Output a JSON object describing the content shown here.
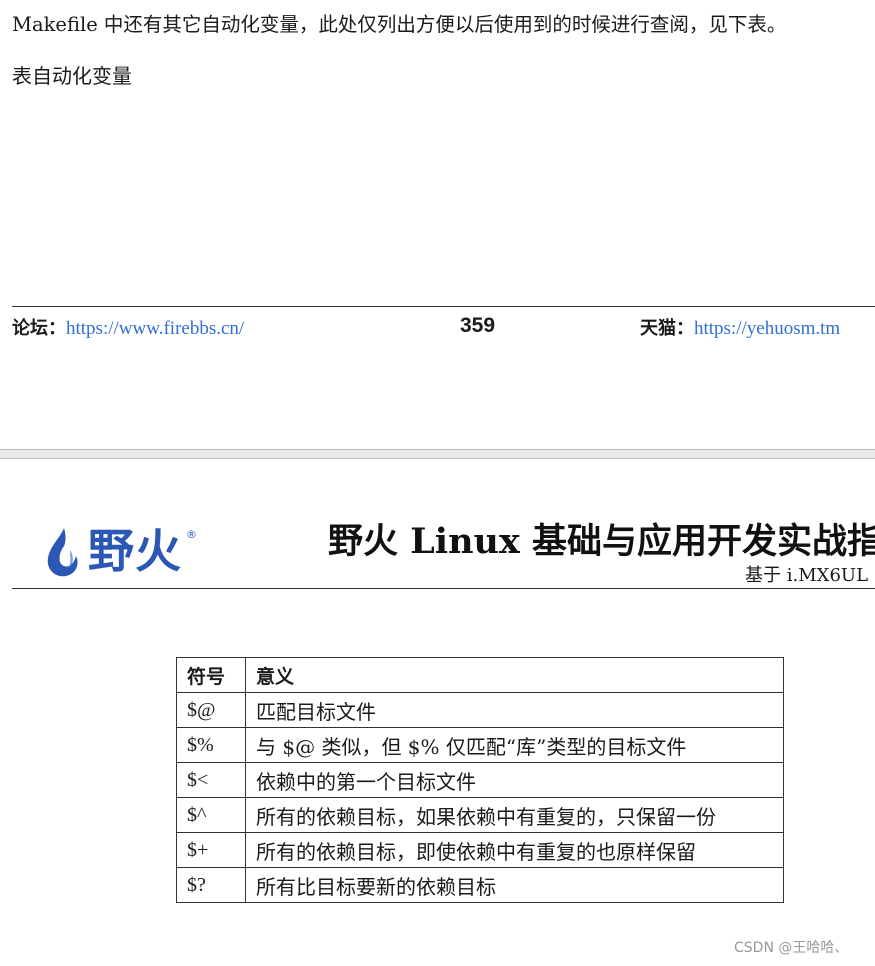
{
  "page_top": {
    "paragraph": "Makefile 中还有其它自动化变量，此处仅列出方便以后使用到的时候进行查阅，见下表。",
    "table_caption": "表自动化变量",
    "footer": {
      "forum_label": "论坛：",
      "forum_url": "https://www.firebbs.cn/",
      "page_number": "359",
      "tmall_label": "天猫：",
      "tmall_url": "https://yehuosm.tm"
    }
  },
  "page_bottom": {
    "logo_text": "野火",
    "logo_reg": "®",
    "book_title": "野火 Linux 基础与应用开发实战指",
    "book_subtitle": "基于 i.MX6UL",
    "table": {
      "headers": [
        "符号",
        "意义"
      ],
      "rows": [
        [
          "$@",
          "匹配目标文件"
        ],
        [
          "$%",
          "与 $@ 类似，但 $% 仅匹配“库”类型的目标文件"
        ],
        [
          "$<",
          "依赖中的第一个目标文件"
        ],
        [
          "$^",
          "所有的依赖目标，如果依赖中有重复的，只保留一份"
        ],
        [
          "$+",
          "所有的依赖目标，即使依赖中有重复的也原样保留"
        ],
        [
          "$?",
          "所有比目标要新的依赖目标"
        ]
      ]
    }
  },
  "watermark": "CSDN @王哈哈、",
  "colors": {
    "link": "#2f6fd6",
    "logo": "#2b57b5",
    "rule": "#333333"
  },
  "icons": [
    "flame-logo-icon"
  ]
}
